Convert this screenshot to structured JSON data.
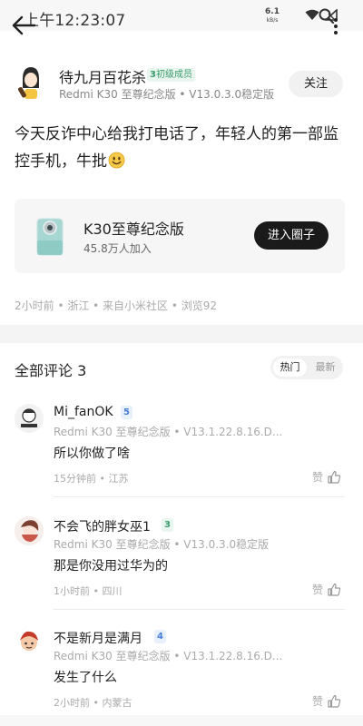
{
  "status": {
    "time": "上午12:23:07",
    "speed_value": "6.1",
    "speed_unit": "kB/s"
  },
  "post": {
    "author": {
      "name": "待九月百花杀",
      "level_num": "3",
      "level_label": "初级成员",
      "device": "Redmi K30 至尊纪念版 • V13.0.3.0稳定版"
    },
    "follow_label": "关注",
    "text": "今天反诈中心给我打电话了，年轻人的第一部监控手机，牛批",
    "circle": {
      "name": "K30至尊纪念版",
      "members": "45.8万人加入",
      "enter_label": "进入圈子"
    },
    "meta": "2小时前 • 浙江 • 来自小米社区 • 浏览92"
  },
  "comments_section": {
    "title": "全部评论 3",
    "sort_hot": "热门",
    "sort_new": "最新",
    "items": [
      {
        "name": "Mi_fanOK",
        "level": "5",
        "level_color": "#4a7fd6",
        "level_bg": "#e8f0fc",
        "device": "Redmi K30 至尊纪念版 • V13.1.22.8.16.D...",
        "text": "所以你做了啥",
        "meta": "15分钟前 • 江苏",
        "like_label": "赞"
      },
      {
        "name": "不会飞的胖女巫1",
        "level": "3",
        "level_color": "#3a9b6b",
        "level_bg": "#e9f6ef",
        "device": "Redmi K30 至尊纪念版 • V13.0.3.0稳定版",
        "text": "那是你没用过华为的",
        "meta": "1小时前 • 四川",
        "like_label": "赞"
      },
      {
        "name": "不是新月是满月",
        "level": "4",
        "level_color": "#4a7fd6",
        "level_bg": "#e8f0fc",
        "device": "Redmi K30 至尊纪念版 • V13.1.22.8.16.D...",
        "text": "发生了什么",
        "meta": "2小时前 • 内蒙古",
        "like_label": "赞"
      }
    ]
  },
  "colors": {
    "accent_dark": "#1a1a1a",
    "muted_text": "#aaaaaa",
    "card_bg": "#f6f6f7"
  },
  "icons": [
    "back-arrow-icon",
    "more-vertical-icon",
    "wifi-icon",
    "signal-icon",
    "search-icon",
    "smile-emoji-icon",
    "thumbs-up-icon"
  ]
}
